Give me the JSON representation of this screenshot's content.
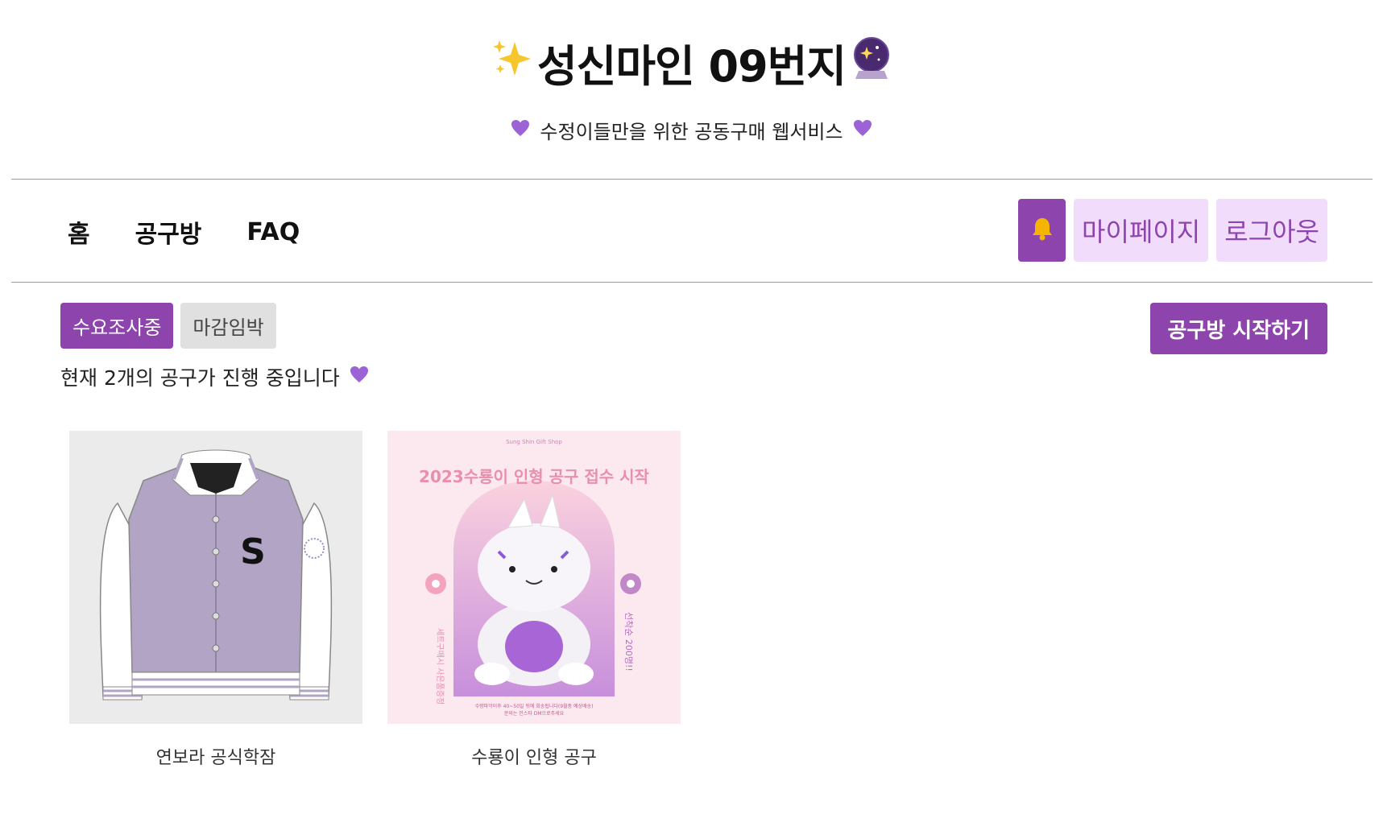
{
  "site": {
    "title": "성신마인 09번지",
    "subtitle": "수정이들만을 위한 공동구매 웹서비스"
  },
  "icons": {
    "title_left": "sparkles-icon",
    "title_right": "crystal-ball-icon",
    "heart": "purple-heart-icon",
    "bell": "bell-icon"
  },
  "colors": {
    "accent": "#8e44ad",
    "accent_light": "#f1dcfb",
    "inactive": "#e0e0e0",
    "bell": "#f5b400"
  },
  "nav": {
    "items": [
      "홈",
      "공구방",
      "FAQ"
    ],
    "mypage": "마이페이지",
    "logout": "로그아웃"
  },
  "filters": {
    "active": "수요조사중",
    "inactive": "마감임박"
  },
  "start_button": "공구방 시작하기",
  "count_text": "현재 2개의 공구가 진행 중입니다",
  "items": [
    {
      "title": "연보라 공식학잠",
      "image": "lavender-varsity-jacket-image",
      "letter": "S"
    },
    {
      "title": "수룡이 인형 공구",
      "image": "plush-doll-poster-image",
      "poster": {
        "shop": "Sung Shin Gift Shop",
        "headline": "2023수룡이 인형 공구 접수 시작",
        "left_side": "세트구매시 사은품증정",
        "right_side": "선착순 200명!!",
        "footer_1": "수량파악이후 40~50일 뒤에 회송됩니다(9월중 예상배송)",
        "footer_2": "문의는 인스타 DM으로주세요"
      }
    }
  ]
}
